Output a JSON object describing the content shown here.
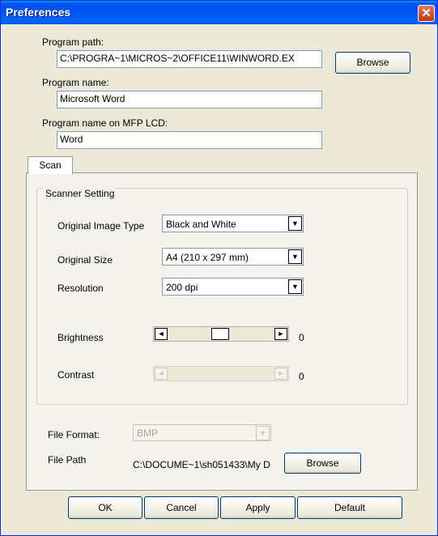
{
  "window": {
    "title": "Preferences",
    "close_glyph": "✕"
  },
  "program": {
    "path_label": "Program path:",
    "path_value": "C:\\PROGRA~1\\MICROS~2\\OFFICE11\\WINWORD.EX",
    "browse_label": "Browse",
    "name_label": "Program name:",
    "name_value": "Microsoft Word",
    "lcd_label": "Program name on MFP LCD:",
    "lcd_value": "Word"
  },
  "tabs": [
    {
      "label": "Scan"
    }
  ],
  "scanner": {
    "group_label": "Scanner Setting",
    "image_type_label": "Original Image Type",
    "image_type_value": "Black and White",
    "size_label": "Original Size",
    "size_value": "A4 (210 x 297 mm)",
    "resolution_label": "Resolution",
    "resolution_value": "200 dpi",
    "brightness_label": "Brightness",
    "brightness_value": "0",
    "contrast_label": "Contrast",
    "contrast_value": "0"
  },
  "file": {
    "format_label": "File Format:",
    "format_value": "BMP",
    "path_label": "File Path",
    "path_value": "C:\\DOCUME~1\\sh051433\\My D",
    "browse_label": "Browse"
  },
  "buttons": {
    "ok": "OK",
    "cancel": "Cancel",
    "apply": "Apply",
    "default": "Default"
  },
  "icons": {
    "dropdown": "▼",
    "left": "◄",
    "right": "►"
  }
}
